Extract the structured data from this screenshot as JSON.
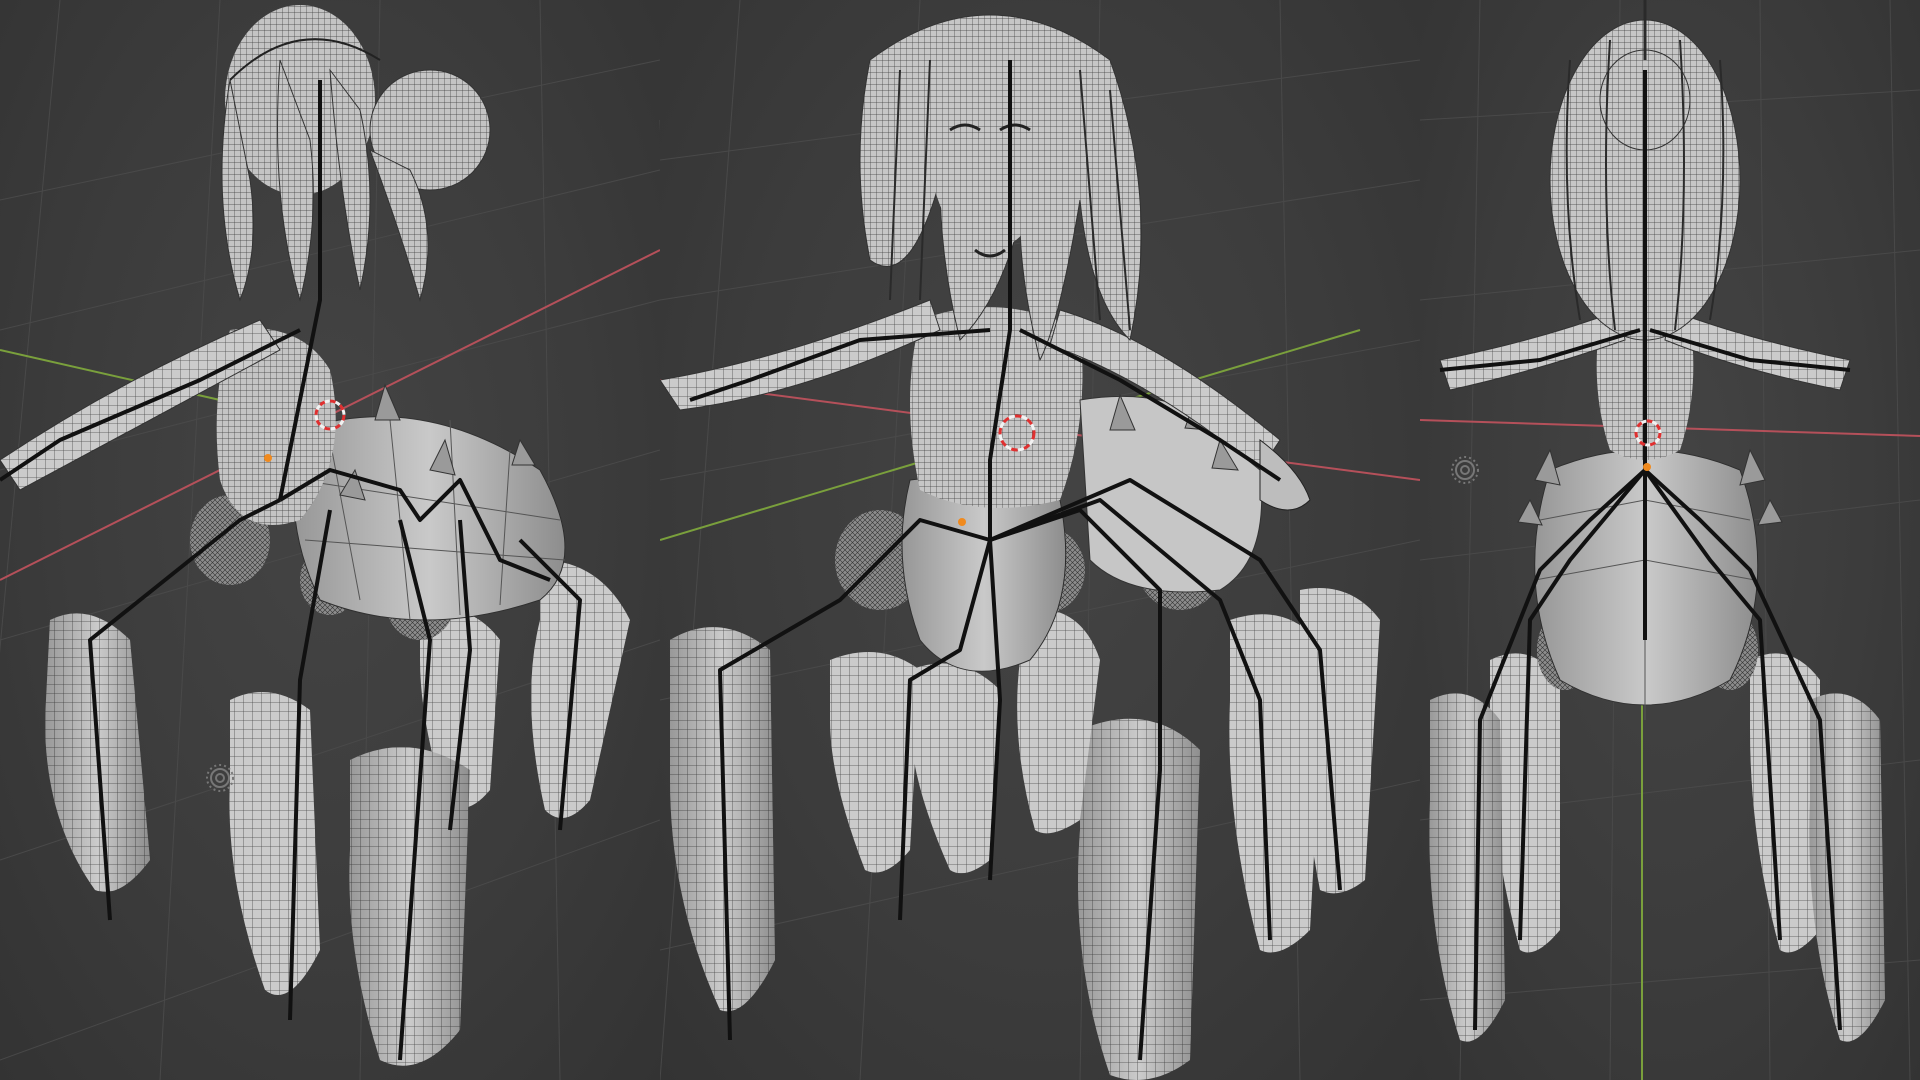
{
  "app": {
    "name": "",
    "mode": ""
  },
  "scene": {
    "subject": "",
    "views": [
      {
        "id": "back-three-quarter",
        "label": ""
      },
      {
        "id": "front",
        "label": ""
      },
      {
        "id": "back",
        "label": ""
      }
    ]
  },
  "colors": {
    "background": "#3a3a3a",
    "grid_line": "#4a4a4a",
    "axis_x": "#b5505a",
    "axis_y": "#7aa03c",
    "mesh_fill": "#cfcfcf",
    "mesh_shade": "#9a9a9a",
    "wire": "#2b2b2b",
    "bone": "#111111",
    "origin": "#f08a1e",
    "cursor_red": "#e03030",
    "cursor_white": "#f2f2f2"
  },
  "icons": [
    "3d-cursor-icon",
    "light-gizmo-icon"
  ]
}
